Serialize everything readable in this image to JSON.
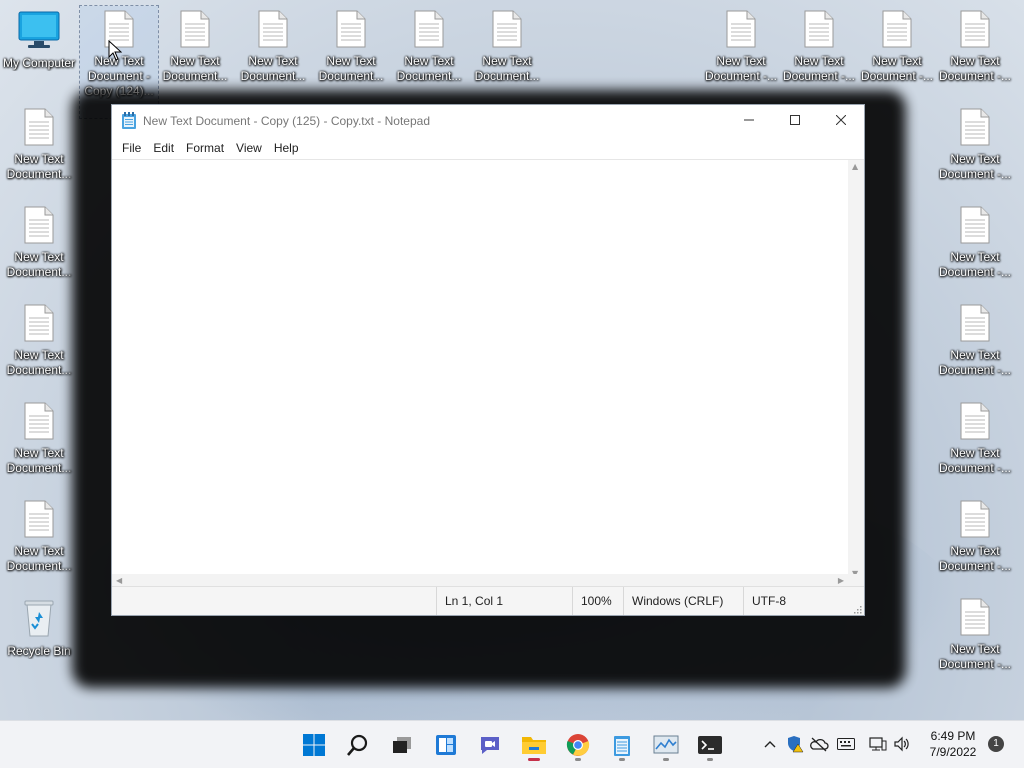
{
  "desktop": {
    "my_computer": "My Computer",
    "recycle_bin": "Recycle Bin",
    "selected_icon": {
      "line1": "New Text",
      "line2": "Document -",
      "line3": "Copy (124)..."
    },
    "top_row": [
      "New Text Document...",
      "New Text Document...",
      "New Text Document...",
      "New Text Document...",
      "New Text Document..."
    ],
    "top_right_row": [
      "New Text Document -...",
      "New Text Document -...",
      "New Text Document -...",
      "New Text Document -..."
    ],
    "left_column": [
      "New Text Document...",
      "New Text Document...",
      "New Text Document...",
      "New Text Document...",
      "New Text Document..."
    ],
    "right_column": [
      "New Text Document -...",
      "New Text Document -...",
      "New Text Document -...",
      "New Text Document -...",
      "New Text Document -...",
      "New Text Document -..."
    ]
  },
  "notepad": {
    "title": "New Text Document - Copy (125) - Copy.txt - Notepad",
    "menu": [
      "File",
      "Edit",
      "Format",
      "View",
      "Help"
    ],
    "content": "",
    "status": {
      "position": "Ln 1, Col 1",
      "zoom": "100%",
      "line_ending": "Windows (CRLF)",
      "encoding": "UTF-8"
    }
  },
  "taskbar": {
    "apps": [
      "start-icon",
      "search-icon",
      "task-view-icon",
      "widgets-icon",
      "chat-icon",
      "file-explorer-icon",
      "chrome-icon",
      "notepad-icon",
      "task-manager-icon",
      "terminal-icon"
    ],
    "time": "6:49 PM",
    "date": "7/9/2022",
    "notification_count": "1"
  },
  "colors": {
    "accent": "#0067c0",
    "start_blue": "#0078d4",
    "active_dot": "#c5304a"
  }
}
